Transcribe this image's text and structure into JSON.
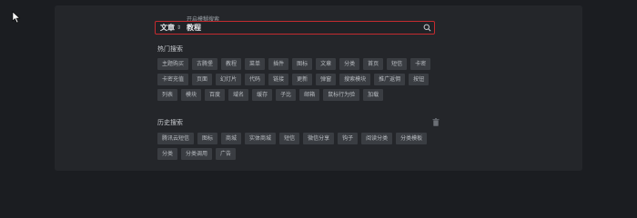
{
  "search": {
    "hint": "开启模糊搜索",
    "scope_label": "文章",
    "query": "教程"
  },
  "hot": {
    "title": "热门搜索",
    "tags": [
      "主题购买",
      "古腾堡",
      "教程",
      "菜单",
      "插件",
      "图标",
      "文章",
      "分类",
      "首页",
      "短信",
      "卡密",
      "卡密充值",
      "页面",
      "幻灯片",
      "代码",
      "链接",
      "更新",
      "弹窗",
      "搜索模块",
      "推广返佣",
      "按钮",
      "列表",
      "模块",
      "百度",
      "域名",
      "缓存",
      "子比",
      "邮箱",
      "鼠标行为验",
      "加载"
    ]
  },
  "history": {
    "title": "历史搜索",
    "tags": [
      "腾讯云短信",
      "图标",
      "商城",
      "实体商城",
      "短信",
      "微信分享",
      "钩子",
      "阅读分类",
      "分类模板",
      "分类",
      "分类调用",
      "广告"
    ]
  }
}
